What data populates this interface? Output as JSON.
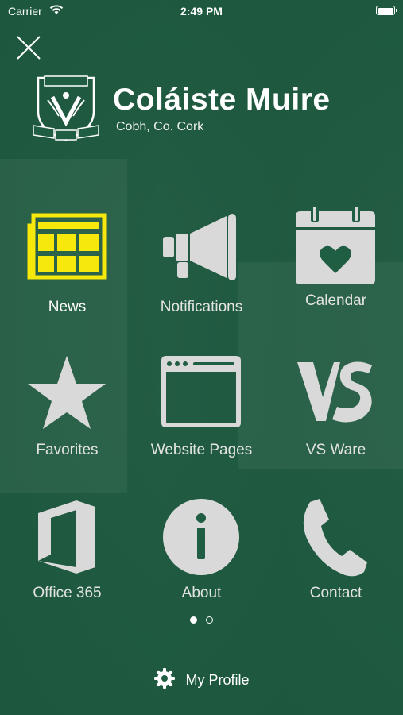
{
  "status_bar": {
    "carrier": "Carrier",
    "time": "2:49 PM"
  },
  "header": {
    "school_name": "Coláiste Muire",
    "location": "Cobh, Co. Cork"
  },
  "tiles": [
    {
      "label": "News",
      "icon": "newspaper-icon",
      "selected": true
    },
    {
      "label": "Notifications",
      "icon": "megaphone-icon"
    },
    {
      "label": "Calendar",
      "icon": "calendar-heart-icon"
    },
    {
      "label": "Favorites",
      "icon": "star-icon"
    },
    {
      "label": "Website Pages",
      "icon": "browser-window-icon"
    },
    {
      "label": "VS Ware",
      "icon": "vs-ware-logo-icon"
    },
    {
      "label": "Office 365",
      "icon": "office-365-icon"
    },
    {
      "label": "About",
      "icon": "info-icon"
    },
    {
      "label": "Contact",
      "icon": "phone-icon"
    }
  ],
  "pager": {
    "current_page": 1,
    "total_pages": 2
  },
  "footer": {
    "profile_label": "My Profile",
    "icon": "gear-icon"
  },
  "colors": {
    "background": "#1f5e42",
    "icon": "#d9d9d9",
    "selected": "#f5e80a"
  }
}
